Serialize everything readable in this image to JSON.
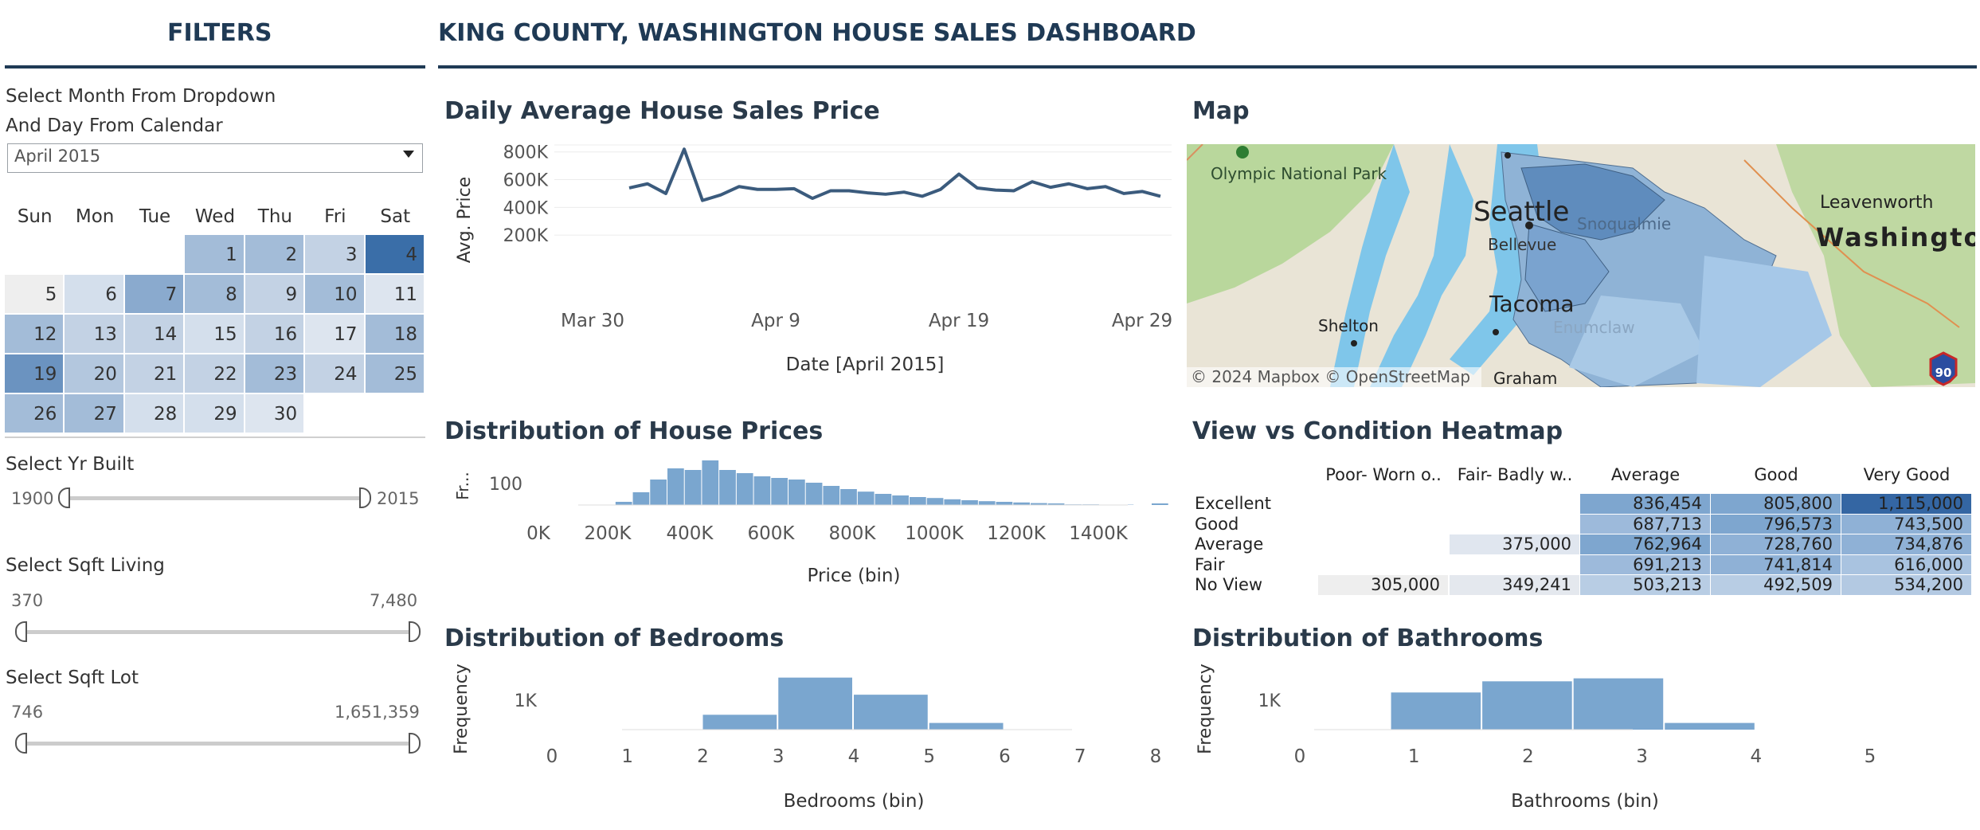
{
  "filters": {
    "title": "FILTERS",
    "instruction_line1": "Select Month From Dropdown",
    "instruction_line2": "And Day From Calendar",
    "month_selected": "April 2015",
    "calendar": {
      "weekdays": [
        "Sun",
        "Mon",
        "Tue",
        "Wed",
        "Thu",
        "Fri",
        "Sat"
      ],
      "days": [
        "1",
        "2",
        "3",
        "4",
        "5",
        "6",
        "7",
        "8",
        "9",
        "10",
        "11",
        "12",
        "13",
        "14",
        "15",
        "16",
        "17",
        "18",
        "19",
        "20",
        "21",
        "22",
        "23",
        "24",
        "25",
        "26",
        "27",
        "28",
        "29",
        "30"
      ],
      "first_weekday_index": 3,
      "day_colors": [
        "#a3bcd8",
        "#a3bcd8",
        "#c3d2e4",
        "#3a6ea8",
        "#eeeeee",
        "#d4dfec",
        "#8aaace",
        "#a3bcd8",
        "#c3d2e4",
        "#a3bcd8",
        "#dde5ef",
        "#a3bcd8",
        "#c3d2e4",
        "#c3d2e4",
        "#d4dfec",
        "#c3d2e4",
        "#dde5ef",
        "#a3bcd8",
        "#6b93c0",
        "#b3c7de",
        "#c3d2e4",
        "#c3d2e4",
        "#a3bcd8",
        "#c3d2e4",
        "#a3bcd8",
        "#a3bcd8",
        "#a3bcd8",
        "#d4dfec",
        "#d4dfec",
        "#dde5ef"
      ]
    },
    "yr_built": {
      "label": "Select Yr Built",
      "min": "1900",
      "max": "2015"
    },
    "sqft_living": {
      "label": "Select Sqft Living",
      "min": "370",
      "max": "7,480"
    },
    "sqft_lot": {
      "label": "Select  Sqft Lot",
      "min": "746",
      "max": "1,651,359"
    }
  },
  "header": {
    "title": "KING COUNTY, WASHINGTON HOUSE SALES DASHBOARD"
  },
  "sections": {
    "daily_avg_title": "Daily Average House Sales Price",
    "map_title": "Map",
    "price_dist_title": "Distribution of House Prices",
    "heatmap_title": "View vs Condition Heatmap",
    "bedrooms_title": "Distribution of Bedrooms",
    "bathrooms_title": "Distribution of Bathrooms"
  },
  "map": {
    "labels": [
      "Olympic National Park",
      "Seattle",
      "Bellevue",
      "Snoqualmie",
      "Leavenworth",
      "Washington",
      "Shelton",
      "Tacoma",
      "Enumclaw",
      "Graham"
    ],
    "copyright": "© 2024 Mapbox  © OpenStreetMap",
    "shield": "90",
    "colors": {
      "land": "#e8e4d8",
      "water": "#7fc6ea",
      "region": "#8fb3d6",
      "region_dark": "#5a87b8",
      "forest": "#b8d79a"
    }
  },
  "chart_data": [
    {
      "type": "line",
      "title": "Daily Average House Sales Price",
      "xlabel": "Date [April 2015]",
      "ylabel": "Avg. Price",
      "x_ticks": [
        "Mar 30",
        "Apr 9",
        "Apr 19",
        "Apr 29"
      ],
      "y_ticks": [
        "200K",
        "400K",
        "600K",
        "800K"
      ],
      "ylim": [
        0,
        850000
      ],
      "x": [
        "Apr 1",
        "Apr 2",
        "Apr 3",
        "Apr 4",
        "Apr 5",
        "Apr 6",
        "Apr 7",
        "Apr 8",
        "Apr 9",
        "Apr 10",
        "Apr 11",
        "Apr 12",
        "Apr 13",
        "Apr 14",
        "Apr 15",
        "Apr 16",
        "Apr 17",
        "Apr 18",
        "Apr 19",
        "Apr 20",
        "Apr 21",
        "Apr 22",
        "Apr 23",
        "Apr 24",
        "Apr 25",
        "Apr 26",
        "Apr 27",
        "Apr 28",
        "Apr 29",
        "Apr 30"
      ],
      "values": [
        540000,
        570000,
        500000,
        820000,
        450000,
        490000,
        550000,
        530000,
        530000,
        535000,
        465000,
        520000,
        520000,
        505000,
        495000,
        510000,
        480000,
        530000,
        640000,
        540000,
        525000,
        520000,
        585000,
        545000,
        570000,
        535000,
        550000,
        500000,
        515000,
        480000
      ],
      "color": "#3b5b7d"
    },
    {
      "type": "bar",
      "title": "Distribution of House Prices",
      "xlabel": "Price (bin)",
      "ylabel": "Fr...",
      "y_ticks": [
        "100"
      ],
      "x_ticks": [
        "0K",
        "200K",
        "400K",
        "600K",
        "800K",
        "1000K",
        "1200K",
        "1400K"
      ],
      "bin_start": 0,
      "bin_width": 40000,
      "xlim": [
        0,
        1400000
      ],
      "values": [
        0,
        0,
        0,
        0,
        10,
        40,
        80,
        115,
        110,
        140,
        110,
        100,
        90,
        85,
        80,
        70,
        60,
        50,
        42,
        35,
        30,
        25,
        22,
        18,
        15,
        12,
        10,
        8,
        6,
        5,
        2,
        2,
        1,
        1,
        0,
        5,
        0,
        0,
        0,
        0
      ],
      "ylim": [
        0,
        160
      ],
      "color": "#7aa6cf"
    },
    {
      "type": "bar",
      "title": "Distribution of Bedrooms",
      "xlabel": "Bedrooms (bin)",
      "ylabel": "Frequency",
      "y_ticks": [
        "1K"
      ],
      "x_ticks": [
        "0",
        "1",
        "2",
        "3",
        "4",
        "5",
        "6",
        "7",
        "8"
      ],
      "bins": [
        [
          2,
          3
        ],
        [
          3,
          4
        ],
        [
          4,
          5
        ],
        [
          5,
          6
        ]
      ],
      "values": [
        200,
        700,
        470,
        90
      ],
      "ylim": [
        0,
        750
      ],
      "color": "#7aa6cf"
    },
    {
      "type": "bar",
      "title": "Distribution of Bathrooms",
      "xlabel": "Bathrooms (bin)",
      "ylabel": "Frequency",
      "y_ticks": [
        "1K"
      ],
      "x_ticks": [
        "0",
        "1",
        "2",
        "3",
        "4",
        "5"
      ],
      "bins": [
        [
          0.8,
          1.6
        ],
        [
          1.6,
          2.4
        ],
        [
          2.4,
          3.2
        ],
        [
          3.2,
          4.0
        ]
      ],
      "values": [
        500,
        650,
        690,
        90
      ],
      "ylim": [
        0,
        750
      ],
      "color": "#7aa6cf"
    },
    {
      "type": "heatmap",
      "title": "View vs Condition Heatmap",
      "columns": [
        "Poor- Worn o..",
        "Fair- Badly w..",
        "Average",
        "Good",
        "Very Good"
      ],
      "rows": [
        "Excellent",
        "Good",
        "Average",
        "Fair",
        "No View"
      ],
      "cells": [
        [
          "",
          "",
          "836,454",
          "805,800",
          "1,115,000"
        ],
        [
          "",
          "",
          "687,713",
          "796,573",
          "743,500"
        ],
        [
          "",
          "375,000",
          "762,964",
          "728,760",
          "734,876"
        ],
        [
          "",
          "",
          "691,213",
          "741,814",
          "616,000"
        ],
        [
          "305,000",
          "349,241",
          "503,213",
          "492,509",
          "534,200"
        ]
      ],
      "colors": [
        [
          "",
          "",
          "#7ea6cf",
          "#7ea6cf",
          "#3466a3"
        ],
        [
          "",
          "",
          "#9dbadb",
          "#7ea6cf",
          "#8fb1d6"
        ],
        [
          "",
          "#e0e6ef",
          "#7ea6cf",
          "#8fb1d6",
          "#8fb1d6"
        ],
        [
          "",
          "",
          "#9dbadb",
          "#8fb1d6",
          "#a9c3e0"
        ],
        [
          "#eeeeee",
          "#e4e8ee",
          "#b8cde4",
          "#b8cde4",
          "#b3c9e2"
        ]
      ]
    }
  ]
}
